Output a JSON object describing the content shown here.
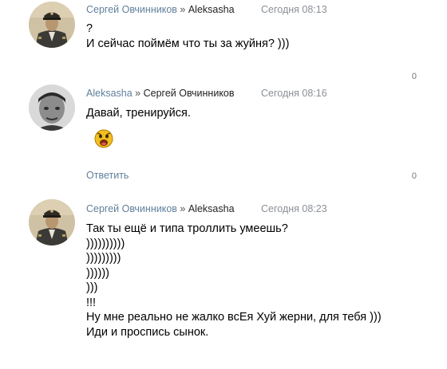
{
  "comments": [
    {
      "author": "Сергей Овчинников",
      "separator": "»",
      "reply_to": "Aleksasha",
      "time": "Сегодня 08:13",
      "lines": [
        "?",
        "И сейчас поймём что ты за жуйня? )))"
      ],
      "likes": "0"
    },
    {
      "author": "Aleksasha",
      "separator": "»",
      "reply_to": "Сергей Овчинников",
      "time": "Сегодня 08:16",
      "lines": [
        "Давай, тренируйся."
      ],
      "sticker_icon": "emoji-sticker-icon",
      "reply_label": "Ответить",
      "likes": "0"
    },
    {
      "author": "Сергей Овчинников",
      "separator": "»",
      "reply_to": "Aleksasha",
      "time": "Сегодня 08:23",
      "lines": [
        "Так ты ещё и типа троллить умеешь?",
        "))))))))))",
        ")))))))))",
        "))))))",
        ")))",
        "!!!",
        "Ну мне реально не жалко всЕя Хуй жерни, для тебя )))",
        "Иди и проспись сынок."
      ]
    }
  ],
  "colors": {
    "link": "#5f7f9b",
    "timestamp": "#8a8f96",
    "text": "#000000"
  }
}
